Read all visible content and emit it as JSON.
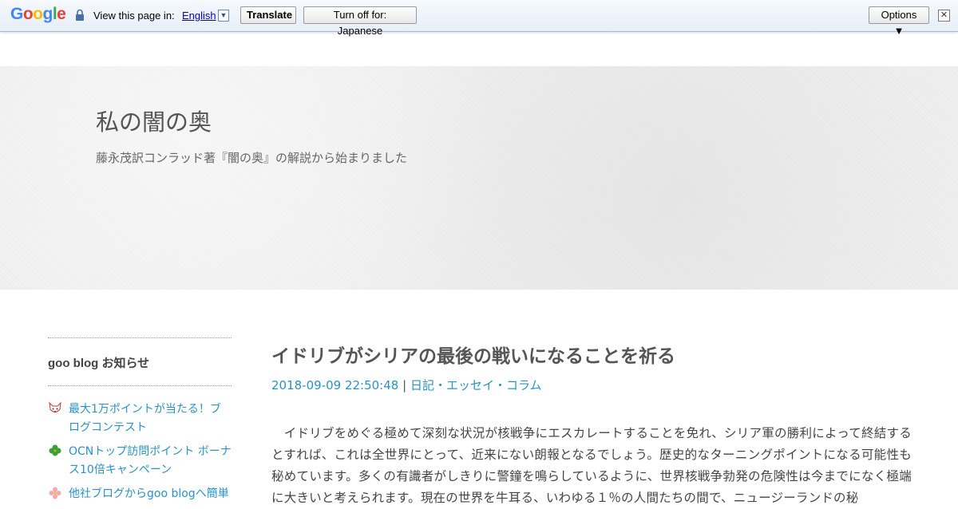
{
  "translate_bar": {
    "logo_letters": [
      {
        "char": "G",
        "color": "#4285f4"
      },
      {
        "char": "o",
        "color": "#ea4335"
      },
      {
        "char": "o",
        "color": "#fbbc05"
      },
      {
        "char": "g",
        "color": "#4285f4"
      },
      {
        "char": "l",
        "color": "#34a853"
      },
      {
        "char": "e",
        "color": "#ea4335"
      }
    ],
    "lock_icon": "lock-icon",
    "view_label": "View this page in:",
    "language": "English",
    "dropdown_arrow": "▼",
    "translate_button": "Translate",
    "turn_off_button": "Turn off for: Japanese",
    "options_button": "Options ▼",
    "close_button": "✕"
  },
  "header": {
    "title": "私の闇の奥",
    "description": "藤永茂訳コンラッド著『闇の奥』の解説から始まりました"
  },
  "sidebar": {
    "heading": "goo blog お知らせ",
    "items": [
      {
        "label": "最大1万ポイントが当たる！ブログコンテスト",
        "icon": "fox-icon"
      },
      {
        "label": "OCNトップ訪問ポイント ボーナス10倍キャンペーン",
        "icon": "clover-icon"
      },
      {
        "label": "他社ブログからgoo blogへ簡単",
        "icon": "flower-icon"
      }
    ]
  },
  "post": {
    "title": "イドリブがシリアの最後の戦いになることを祈る",
    "date": "2018-09-09 22:50:48",
    "separator": "|",
    "category": "日記・エッセイ・コラム",
    "body": "　イドリブをめぐる極めて深刻な状況が核戦争にエスカレートすることを免れ、シリア軍の勝利によって終結するとすれば、これは全世界にとって、近来にない朗報となるでしょう。歴史的なターニングポイントになる可能性も秘めています。多くの有識者がしきりに警鐘を鳴らしているように、世界核戦争勃発の危険性は今までになく極端に大きいと考えられます。現在の世界を牛耳る、いわゆる１％の人間たちの間で、ニュージーランドの秘"
  },
  "colors": {
    "link": "#2a93c4",
    "text": "#555555",
    "header_bg": "#efefef"
  }
}
